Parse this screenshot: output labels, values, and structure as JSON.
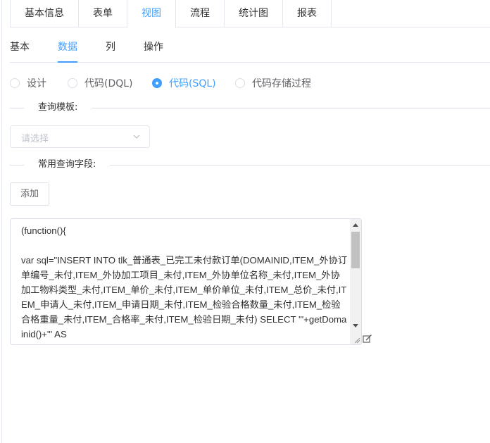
{
  "top_tabs": [
    {
      "label": "基本信息",
      "active": false
    },
    {
      "label": "表单",
      "active": false
    },
    {
      "label": "视图",
      "active": true
    },
    {
      "label": "流程",
      "active": false
    },
    {
      "label": "统计图",
      "active": false
    },
    {
      "label": "报表",
      "active": false
    }
  ],
  "sub_tabs": [
    {
      "label": "基本",
      "active": false
    },
    {
      "label": "数据",
      "active": true
    },
    {
      "label": "列",
      "active": false
    },
    {
      "label": "操作",
      "active": false
    }
  ],
  "radios": [
    {
      "label": "设计",
      "checked": false
    },
    {
      "label": "代码(DQL)",
      "checked": false
    },
    {
      "label": "代码(SQL)",
      "checked": true
    },
    {
      "label": "代码存储过程",
      "checked": false
    }
  ],
  "query_template": {
    "section_label": "查询模板:",
    "placeholder": "请选择"
  },
  "common_fields": {
    "section_label": "常用查询字段:",
    "add_button": "添加"
  },
  "code": "(function(){\n\nvar sql=\"INSERT INTO tlk_普通表_已完工未付款订单(DOMAINID,ITEM_外协订单编号_未付,ITEM_外协加工项目_未付,ITEM_外协单位名称_未付,ITEM_外协加工物料类型_未付,ITEM_单价_未付,ITEM_单价单位_未付,ITEM_总价_未付,ITEM_申请人_未付,ITEM_申请日期_未付,ITEM_检验合格数量_未付,ITEM_检验合格重量_未付,ITEM_合格率_未付,ITEM_检验日期_未付) SELECT '\"+getDomainid()+\"' AS",
  "colors": {
    "accent": "#409eff",
    "border": "#dcdfe6"
  }
}
